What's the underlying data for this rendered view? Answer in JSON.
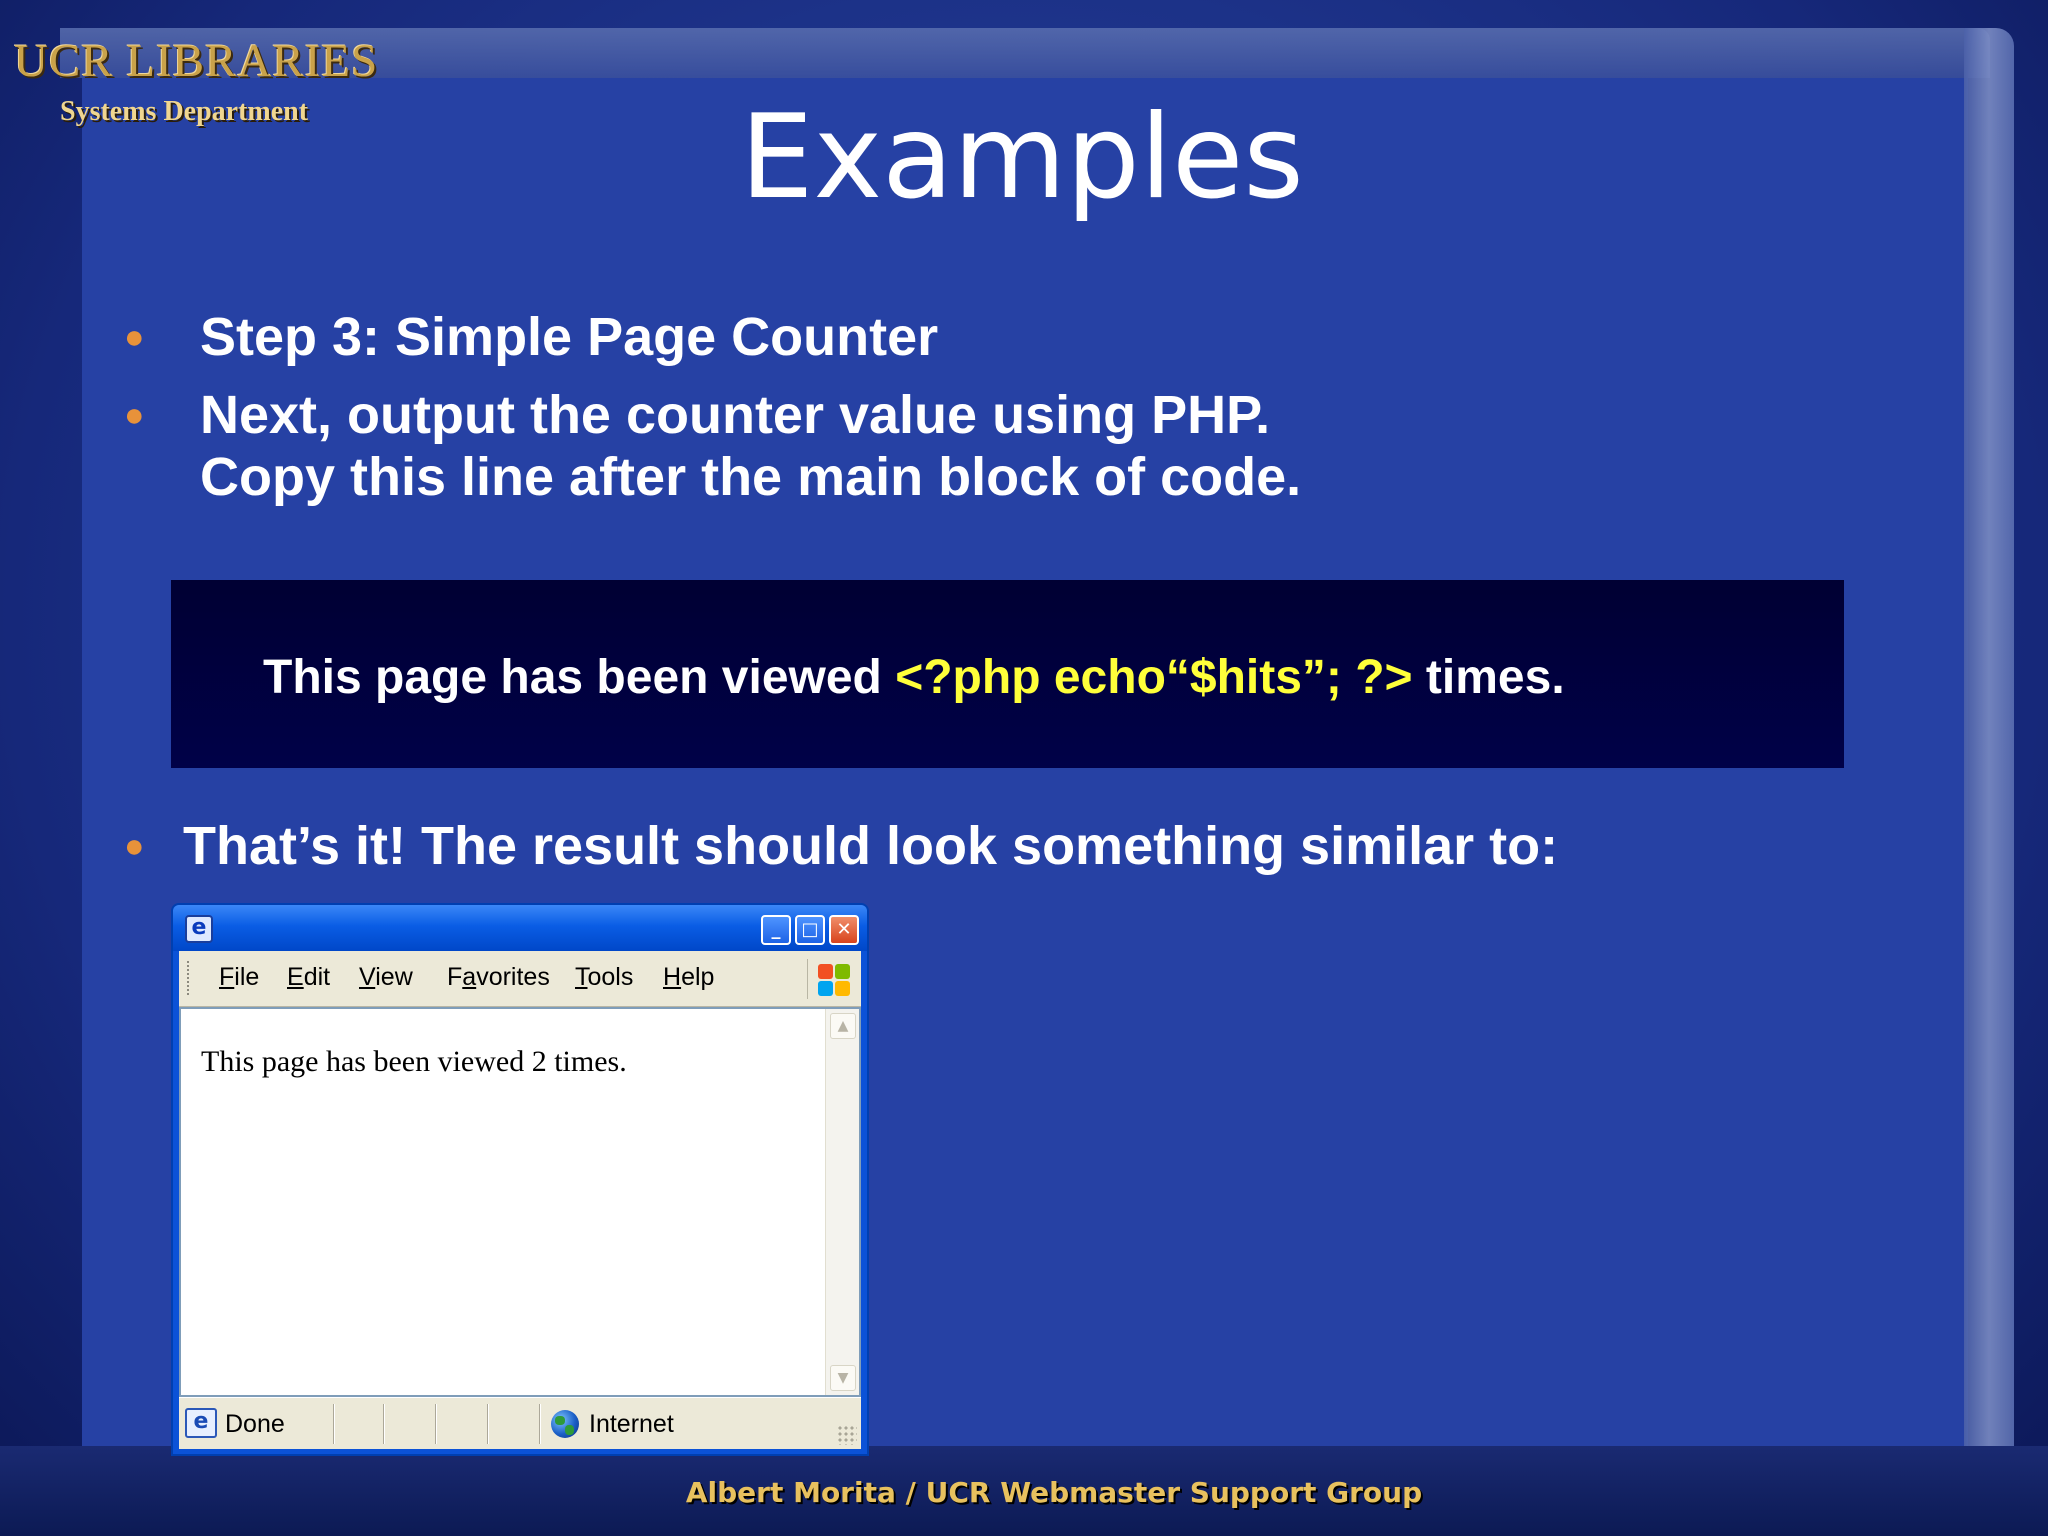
{
  "logo": {
    "main": "UCR LIBRARIES",
    "sub": "Systems Department"
  },
  "slide": {
    "title": "Examples",
    "bullets": [
      "Step 3: Simple Page Counter",
      "Next, output the counter value using PHP.",
      "Copy this line after the main block of code."
    ],
    "code": {
      "prefix": "This page has been viewed ",
      "php": "<?php echo“$hits”; ?>",
      "suffix": " times."
    },
    "result_bullet": "That’s it! The result should look something similar to:"
  },
  "browser": {
    "menu": [
      {
        "pre": "",
        "key": "F",
        "post": "ile"
      },
      {
        "pre": "",
        "key": "E",
        "post": "dit"
      },
      {
        "pre": "",
        "key": "V",
        "post": "iew"
      },
      {
        "pre": "F",
        "key": "a",
        "post": "vorites"
      },
      {
        "pre": "",
        "key": "T",
        "post": "ools"
      },
      {
        "pre": "",
        "key": "H",
        "post": "elp"
      }
    ],
    "content_text": "This page has been viewed 2 times.",
    "status": "Done",
    "zone": "Internet"
  },
  "footer": "Albert Morita / UCR Webmaster Support Group",
  "colors": {
    "slide_bg": "#2641a4",
    "bullet": "#e8923a",
    "php_code": "#ffff3a",
    "footer": "#e8c15e"
  },
  "icons": [
    "ie-icon",
    "minimize-icon",
    "maximize-icon",
    "close-icon",
    "windows-logo-icon",
    "page-done-icon",
    "internet-globe-icon",
    "scroll-up-icon",
    "scroll-down-icon"
  ]
}
